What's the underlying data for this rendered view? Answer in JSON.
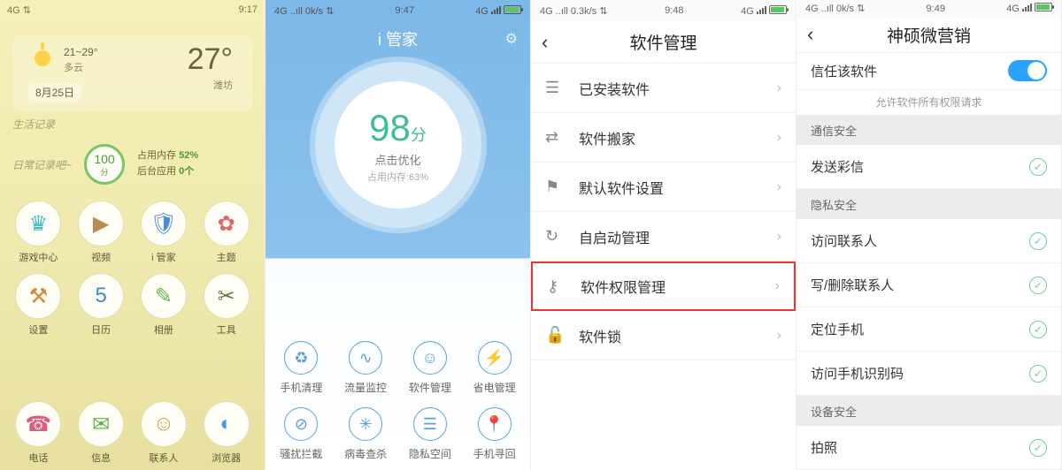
{
  "screen1": {
    "status_left": "4G  ⇅",
    "status_time": "9:17",
    "weather": {
      "range": "21~29°",
      "cond": "多云",
      "big_temp": "27°",
      "city": "潍坊",
      "date": "8月25日"
    },
    "scrawl1": "生活记录",
    "scrawl2": "日常记录吧~",
    "score_value": "100",
    "score_unit": "分",
    "mem_line1_pre": "占用内存 ",
    "mem_line1_val": "52%",
    "mem_line2_pre": "后台应用 ",
    "mem_line2_val": "0个",
    "apps": [
      {
        "label": "游戏中心",
        "glyph": "♛",
        "cls": "ic-crown"
      },
      {
        "label": "视频",
        "glyph": "▶",
        "cls": "ic-video"
      },
      {
        "label": "i 管家",
        "glyph": "🛡",
        "cls": "ic-shield",
        "hi": true
      },
      {
        "label": "主题",
        "glyph": "✿",
        "cls": "ic-theme"
      },
      {
        "label": "设置",
        "glyph": "⚒",
        "cls": "ic-set"
      },
      {
        "label": "日历",
        "glyph": "5",
        "cls": "ic-cal"
      },
      {
        "label": "相册",
        "glyph": "✎",
        "cls": "ic-gal"
      },
      {
        "label": "工具",
        "glyph": "✂",
        "cls": "ic-tool"
      }
    ],
    "dock": [
      {
        "label": "电话",
        "glyph": "☎",
        "cls": "ic-phone"
      },
      {
        "label": "信息",
        "glyph": "✉",
        "cls": "ic-msg"
      },
      {
        "label": "联系人",
        "glyph": "☺",
        "cls": "ic-cont"
      },
      {
        "label": "浏览器",
        "glyph": "◐",
        "cls": "ic-brw"
      }
    ]
  },
  "screen2": {
    "status_left": "4G ..ıll 0k/s ⇅",
    "status_time": "9:47",
    "status_right": "4G",
    "title": "i 管家",
    "score_value": "98",
    "score_unit": "分",
    "sub1": "点击优化",
    "sub2": "占用内存:63%",
    "tools": [
      {
        "label": "手机清理",
        "glyph": "♻"
      },
      {
        "label": "流量监控",
        "glyph": "∿"
      },
      {
        "label": "软件管理",
        "glyph": "☺",
        "hi": true
      },
      {
        "label": "省电管理",
        "glyph": "⚡"
      },
      {
        "label": "骚扰拦截",
        "glyph": "⊘"
      },
      {
        "label": "病毒查杀",
        "glyph": "✳"
      },
      {
        "label": "隐私空间",
        "glyph": "☰"
      },
      {
        "label": "手机寻回",
        "glyph": "📍"
      }
    ]
  },
  "screen3": {
    "status_left": "4G ..ıll 0.3k/s ⇅",
    "status_time": "9:48",
    "status_right": "4G",
    "title": "软件管理",
    "items": [
      {
        "label": "已安装软件",
        "glyph": "☰"
      },
      {
        "label": "软件搬家",
        "glyph": "⇄"
      },
      {
        "label": "默认软件设置",
        "glyph": "⚑"
      },
      {
        "label": "自启动管理",
        "glyph": "↻"
      },
      {
        "label": "软件权限管理",
        "glyph": "⚷",
        "hi": true
      },
      {
        "label": "软件锁",
        "glyph": "🔓"
      }
    ]
  },
  "screen4": {
    "status_left": "4G ..ıll 0k/s ⇅",
    "status_time": "9:49",
    "status_right": "4G",
    "title": "神硕微营销",
    "trust_label": "信任该软件",
    "trust_on": true,
    "hint": "允许软件所有权限请求",
    "sections": [
      {
        "header": "通信安全",
        "rows": [
          {
            "label": "发送彩信"
          }
        ]
      },
      {
        "header": "隐私安全",
        "rows": [
          {
            "label": "访问联系人"
          },
          {
            "label": "写/删除联系人"
          },
          {
            "label": "定位手机"
          },
          {
            "label": "访问手机识别码"
          }
        ]
      },
      {
        "header": "设备安全",
        "rows": [
          {
            "label": "拍照"
          }
        ]
      }
    ]
  }
}
